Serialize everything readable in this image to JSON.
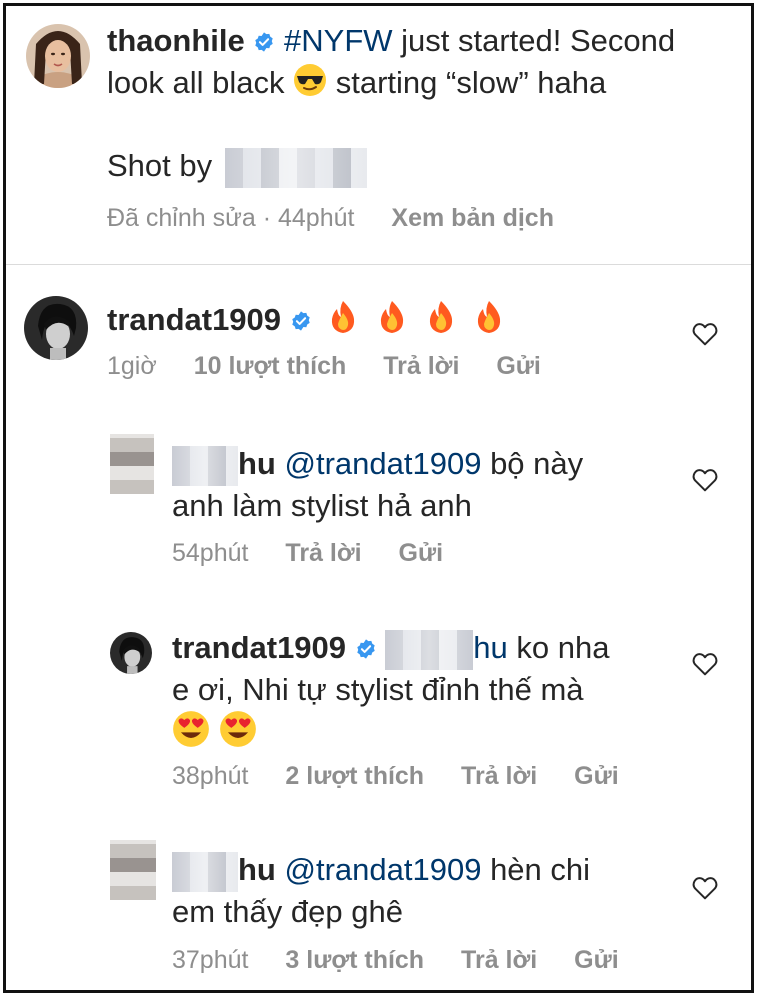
{
  "caption": {
    "username": "thaonhile",
    "hashtag": "#NYFW",
    "text_part1": " just started! Second",
    "text_line2_a": "look all black",
    "text_line2_b": "starting “slow” haha",
    "shot_by": "Shot by",
    "edited": "Đã chỉnh sửa",
    "dot": "·",
    "time": "44phút",
    "translate": "Xem bản dịch"
  },
  "comments": [
    {
      "username": "trandat1909",
      "emoji_icons": [
        "fire-emoji",
        "fire-emoji",
        "fire-emoji",
        "fire-emoji"
      ],
      "time": "1giờ",
      "likes": "10 lượt thích",
      "reply": "Trả lời",
      "send": "Gửi"
    },
    {
      "username_visible_suffix": "hu",
      "mention": "@trandat1909",
      "text_a": " bộ này",
      "text_b": "anh làm stylist hả anh",
      "time": "54phút",
      "reply": "Trả lời",
      "send": "Gửi"
    },
    {
      "username": "trandat1909",
      "mention_suffix": "hu",
      "text_a": " ko nha",
      "text_b": "e ơi, Nhi tự stylist đỉnh thế mà",
      "emoji_icons": [
        "heart-eyes-emoji",
        "heart-eyes-emoji"
      ],
      "time": "38phút",
      "likes": "2 lượt thích",
      "reply": "Trả lời",
      "send": "Gửi"
    },
    {
      "username_visible_suffix": "hu",
      "mention": "@trandat1909",
      "text_a": " hèn chi",
      "text_b": "em thấy đẹp ghê",
      "time": "37phút",
      "likes": "3 lượt thích",
      "reply": "Trả lời",
      "send": "Gửi"
    }
  ],
  "icons": {
    "verified": "verified-badge-icon",
    "heart": "heart-outline-icon",
    "sunglasses": "sunglasses-emoji"
  },
  "colors": {
    "text": "#262626",
    "meta": "#8e8e8e",
    "link": "#00376b",
    "verified": "#3897f0",
    "border": "#111111"
  }
}
